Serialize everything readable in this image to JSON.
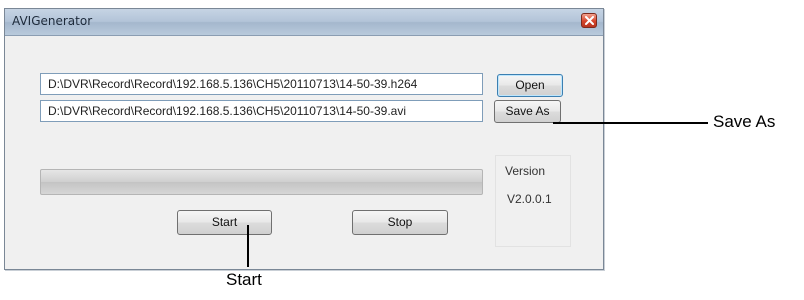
{
  "window": {
    "title": "AVIGenerator"
  },
  "inputs": {
    "source_path": "D:\\DVR\\Record\\Record\\192.168.5.136\\CH5\\20110713\\14-50-39.h264",
    "output_path": "D:\\DVR\\Record\\Record\\192.168.5.136\\CH5\\20110713\\14-50-39.avi"
  },
  "buttons": {
    "open_label": "Open",
    "save_as_label": "Save As",
    "start_label": "Start",
    "stop_label": "Stop"
  },
  "progress": {
    "value_percent": 0
  },
  "version": {
    "label": "Version",
    "value": "V2.0.0.1"
  },
  "callouts": {
    "save_as": "Save As",
    "start": "Start"
  },
  "icons": {
    "close": "close-icon"
  },
  "colors": {
    "close_button": "#d6452b",
    "focus_border": "#3c7fb1"
  }
}
